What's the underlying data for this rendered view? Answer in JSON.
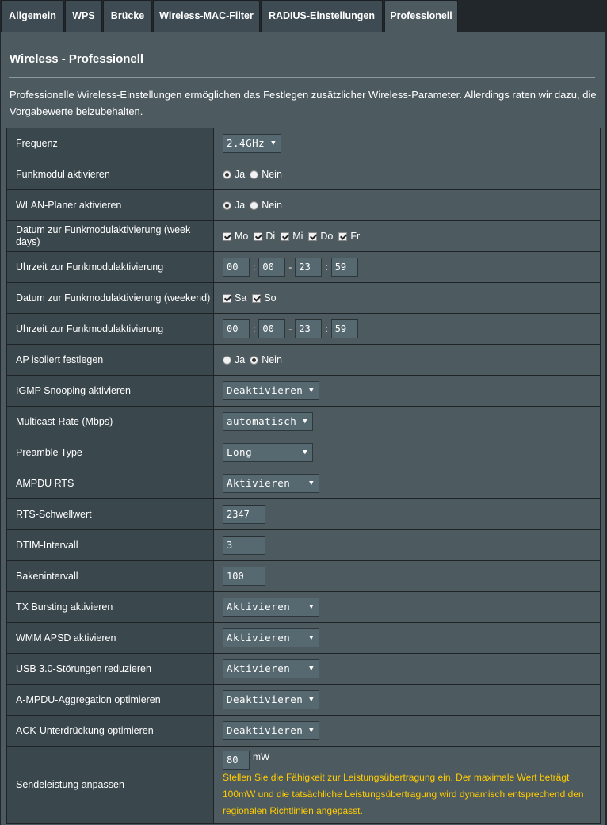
{
  "tabs": [
    {
      "label": "Allgemein"
    },
    {
      "label": "WPS"
    },
    {
      "label": "Brücke"
    },
    {
      "label": "Wireless-MAC-Filter"
    },
    {
      "label": "RADIUS-Einstellungen"
    },
    {
      "label": "Professionell",
      "active": true
    }
  ],
  "page": {
    "title": "Wireless - Professionell",
    "description": "Professionelle Wireless-Einstellungen ermöglichen das Festlegen zusätzlicher Wireless-Parameter. Allerdings raten wir dazu, die Vorgabewerte beizubehalten."
  },
  "settings": {
    "frequency": {
      "label": "Frequenz",
      "value": "2.4GHz"
    },
    "radio_enable": {
      "label": "Funkmodul aktivieren",
      "yes": "Ja",
      "no": "Nein",
      "selected": "Ja"
    },
    "scheduler": {
      "label": "WLAN-Planer aktivieren",
      "yes": "Ja",
      "no": "Nein",
      "selected": "Ja"
    },
    "weekdays": {
      "label": "Datum zur Funkmodulaktivierung (week days)",
      "days": [
        {
          "label": "Mo",
          "checked": true
        },
        {
          "label": "Di",
          "checked": true
        },
        {
          "label": "Mi",
          "checked": true
        },
        {
          "label": "Do",
          "checked": true
        },
        {
          "label": "Fr",
          "checked": true
        }
      ]
    },
    "weekday_time": {
      "label": "Uhrzeit zur Funkmodulaktivierung",
      "start_h": "00",
      "start_m": "00",
      "end_h": "23",
      "end_m": "59"
    },
    "weekend": {
      "label": "Datum zur Funkmodulaktivierung (weekend)",
      "days": [
        {
          "label": "Sa",
          "checked": true
        },
        {
          "label": "So",
          "checked": true
        }
      ]
    },
    "weekend_time": {
      "label": "Uhrzeit zur Funkmodulaktivierung",
      "start_h": "00",
      "start_m": "00",
      "end_h": "23",
      "end_m": "59"
    },
    "ap_isolated": {
      "label": "AP isoliert festlegen",
      "yes": "Ja",
      "no": "Nein",
      "selected": "Nein"
    },
    "igmp": {
      "label": "IGMP Snooping aktivieren",
      "value": "Deaktivieren"
    },
    "multicast": {
      "label": "Multicast-Rate (Mbps)",
      "value": "automatisch"
    },
    "preamble": {
      "label": "Preamble Type",
      "value": "Long"
    },
    "ampdu_rts": {
      "label": "AMPDU RTS",
      "value": "Aktivieren"
    },
    "rts_threshold": {
      "label": "RTS-Schwellwert",
      "value": "2347"
    },
    "dtim": {
      "label": "DTIM-Intervall",
      "value": "3"
    },
    "beacon": {
      "label": "Bakenintervall",
      "value": "100"
    },
    "tx_bursting": {
      "label": "TX Bursting aktivieren",
      "value": "Aktivieren"
    },
    "wmm_apsd": {
      "label": "WMM APSD aktivieren",
      "value": "Aktivieren"
    },
    "usb3": {
      "label": "USB 3.0-Störungen reduzieren",
      "value": "Aktivieren"
    },
    "ampdu_aggr": {
      "label": "A-MPDU-Aggregation optimieren",
      "value": "Deaktivieren"
    },
    "ack_supp": {
      "label": "ACK-Unterdrückung optimieren",
      "value": "Deaktivieren"
    },
    "tx_power": {
      "label": "Sendeleistung anpassen",
      "value": "80",
      "unit": "mW",
      "note": "Stellen Sie die Fähigkeit zur Leistungsübertragung ein. Der maximale Wert beträgt 100mW und die tatsächliche Leistungsübertragung wird dynamisch entsprechend den regionalen Richtlinien angepasst."
    }
  },
  "colors": {
    "background": "#21272a",
    "panel": "#4d5a60",
    "label_cell": "#3a474d",
    "note": "#ffcc00"
  }
}
